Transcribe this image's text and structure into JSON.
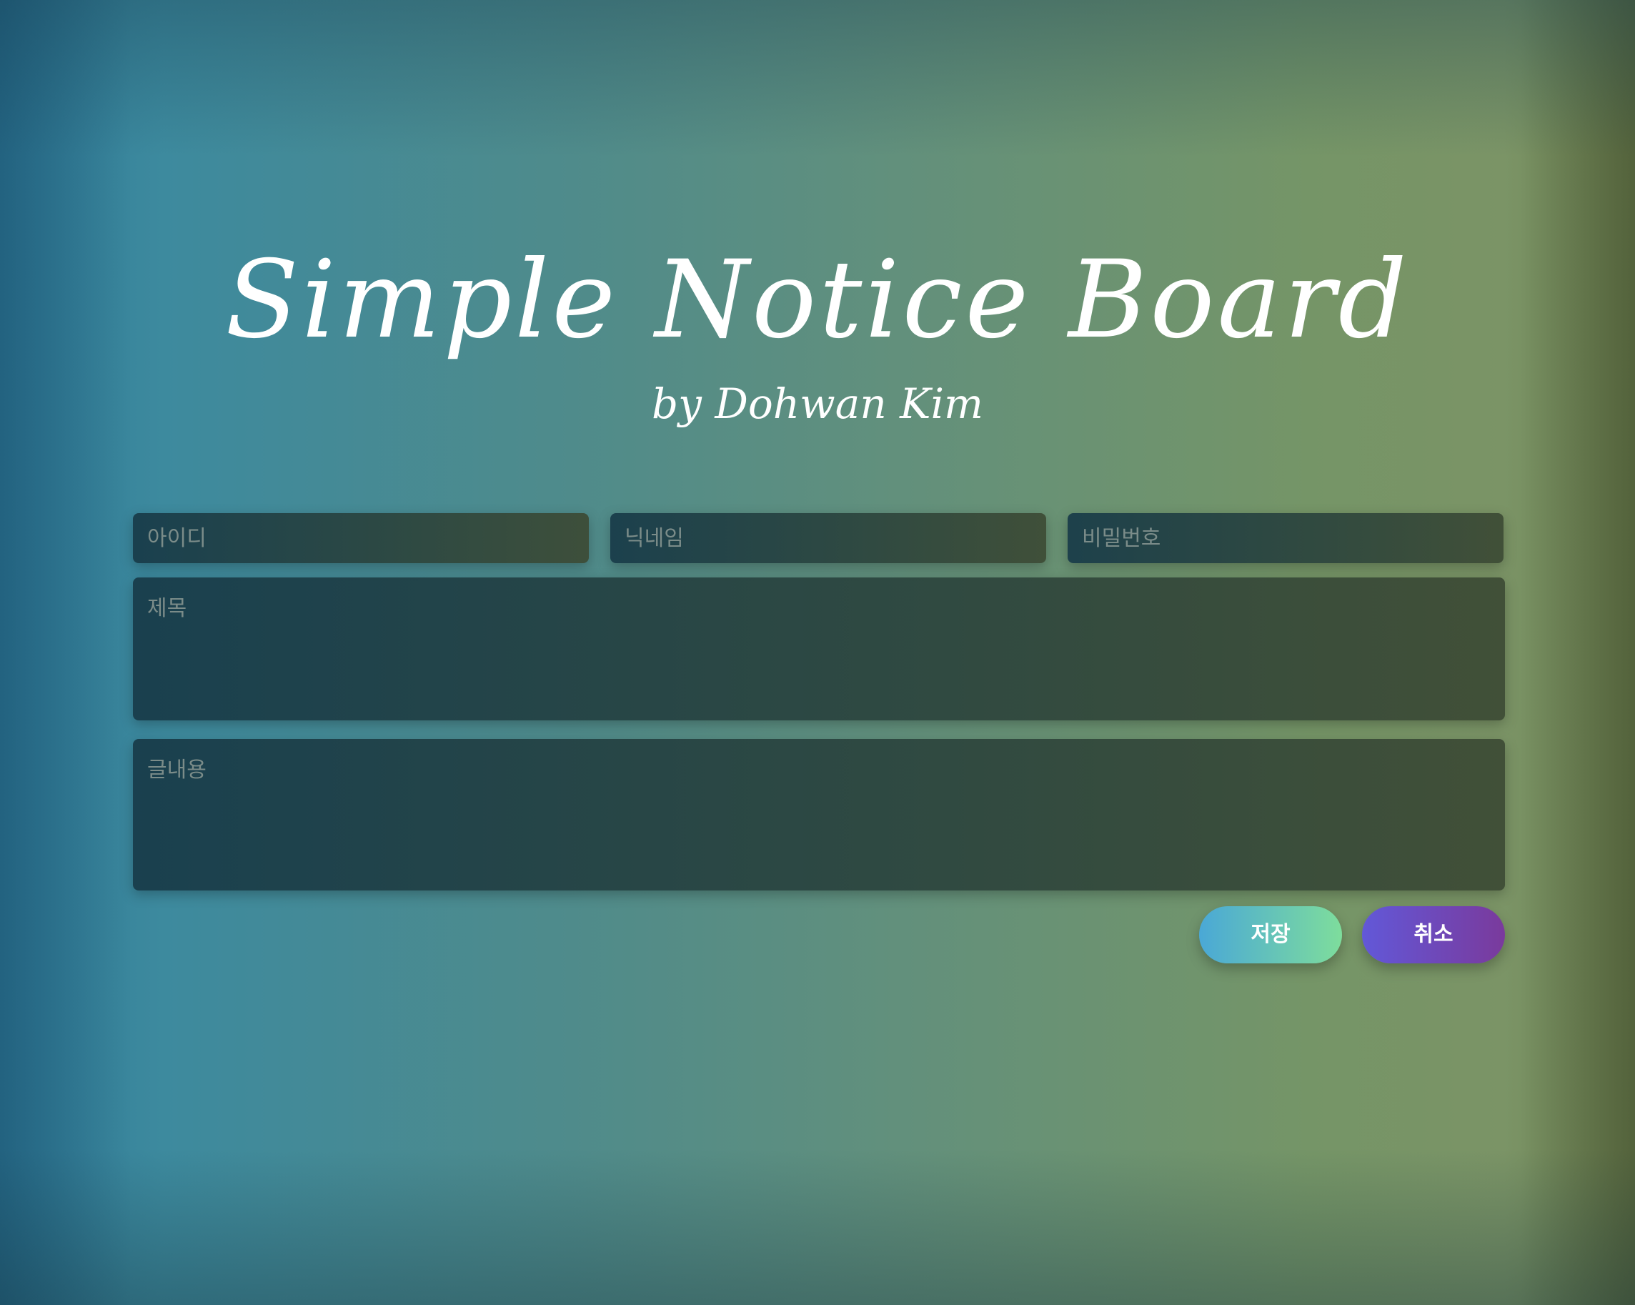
{
  "header": {
    "title": "Simple Notice Board",
    "subtitle": "by Dohwan Kim"
  },
  "form": {
    "id_placeholder": "아이디",
    "nickname_placeholder": "닉네임",
    "password_placeholder": "비밀번호",
    "title_placeholder": "제목",
    "content_placeholder": "글내용",
    "id_value": "",
    "nickname_value": "",
    "password_value": "",
    "title_value": "",
    "content_value": ""
  },
  "actions": {
    "save_label": "저장",
    "cancel_label": "취소"
  },
  "colors": {
    "save_gradient_start": "#4aa8d6",
    "save_gradient_end": "#7edd9c",
    "cancel_gradient_start": "#6258d8",
    "cancel_gradient_end": "#7a3a9c",
    "text": "#ffffff"
  }
}
